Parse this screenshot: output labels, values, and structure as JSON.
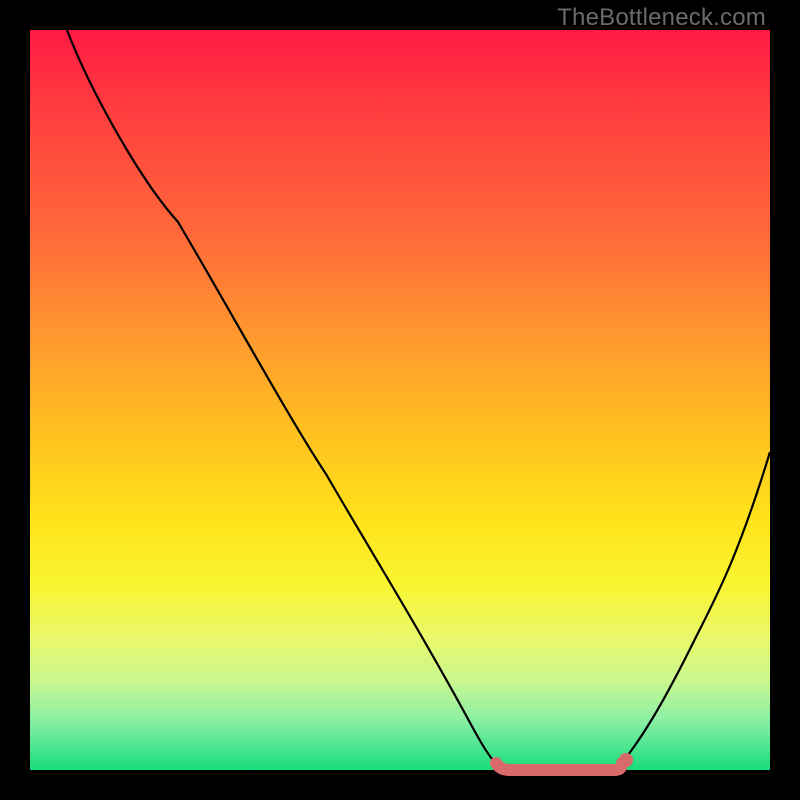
{
  "watermark": "TheBottleneck.com",
  "chart_data": {
    "type": "line",
    "title": "",
    "xlabel": "",
    "ylabel": "",
    "xlim": [
      0,
      100
    ],
    "ylim": [
      0,
      100
    ],
    "grid": false,
    "legend": null,
    "series": [
      {
        "name": "bottleneck-curve",
        "x": [
          5,
          12,
          20,
          28,
          36,
          44,
          52,
          60,
          63,
          66,
          70,
          74,
          78,
          80,
          84,
          90,
          96,
          100
        ],
        "values": [
          100,
          88,
          74,
          60,
          46,
          32,
          18,
          4,
          1,
          0,
          0,
          0,
          0,
          1,
          6,
          18,
          32,
          43
        ]
      }
    ],
    "annotation": {
      "name": "optimal-range-marker",
      "x_range": [
        63,
        80
      ],
      "y": 0,
      "color": "#d96a6a"
    },
    "gradient_stops": [
      {
        "pos": 0,
        "color": "#ff1a44"
      },
      {
        "pos": 28,
        "color": "#ff6a3a"
      },
      {
        "pos": 55,
        "color": "#ffc31f"
      },
      {
        "pos": 75,
        "color": "#f9f531"
      },
      {
        "pos": 100,
        "color": "#17dc7a"
      }
    ]
  }
}
